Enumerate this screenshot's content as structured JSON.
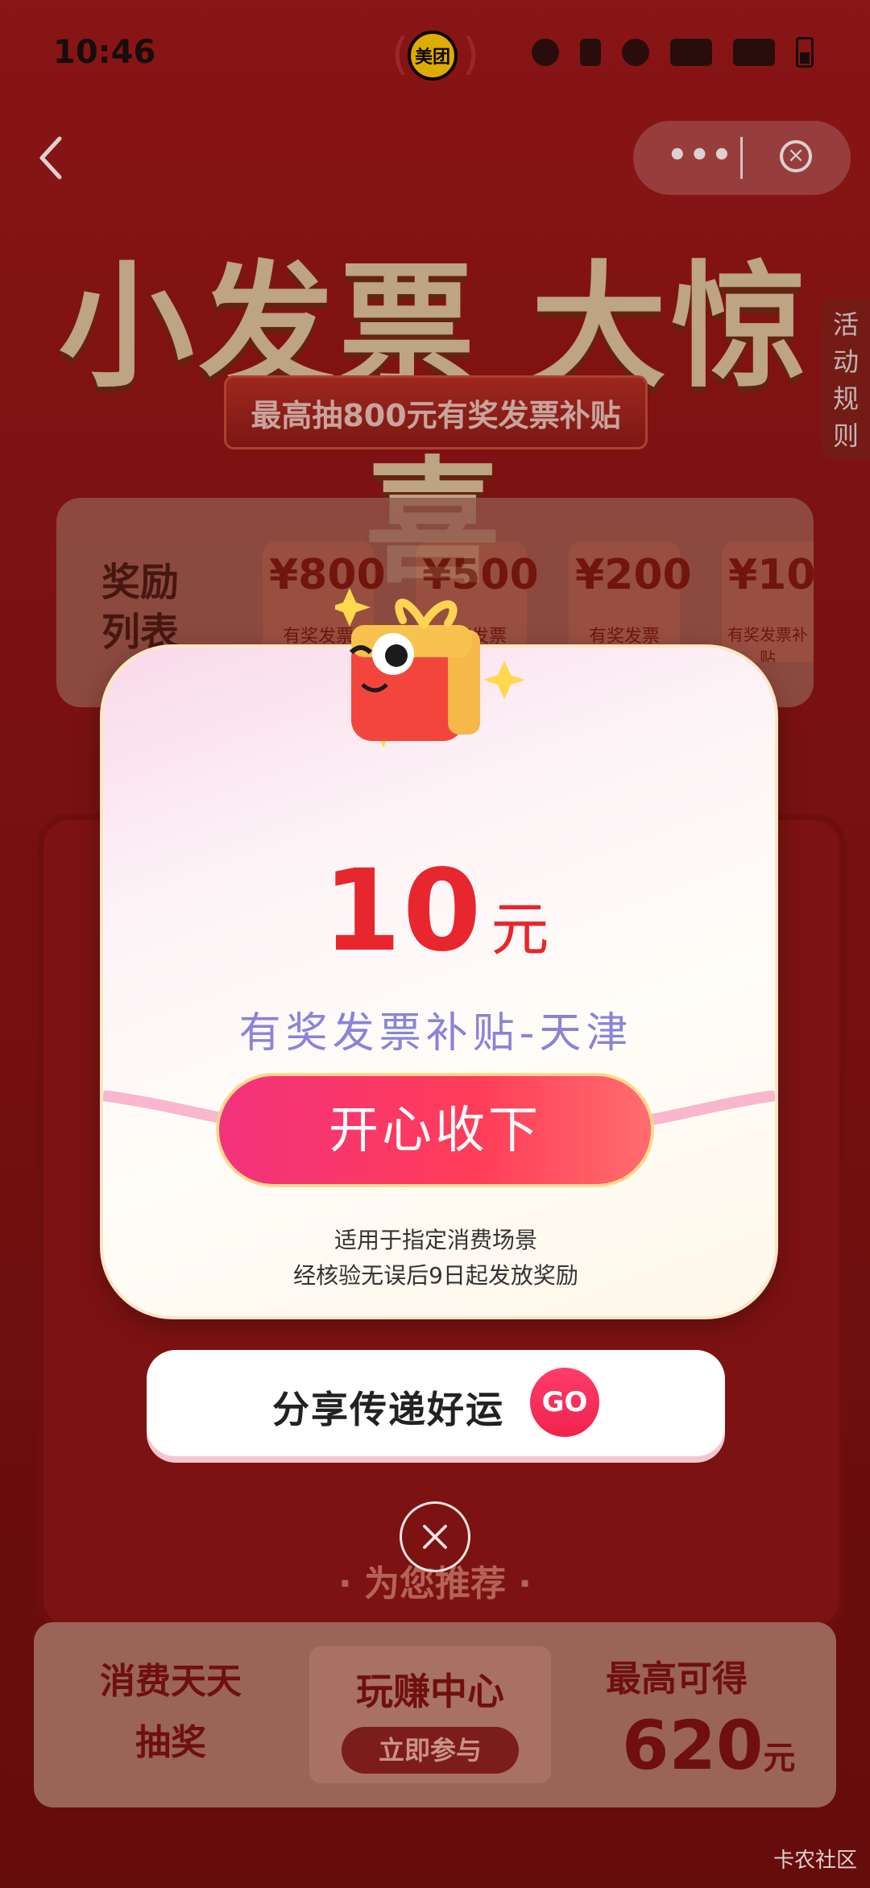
{
  "status_bar": {
    "time": "10:46",
    "app_logo": "美团"
  },
  "nav": {
    "more_label": "•••"
  },
  "hero": {
    "title": "小发票 大惊喜",
    "subtitle": "最高抽800元有奖发票补贴",
    "rules_tab": "活动规则"
  },
  "rewards": {
    "label": "奖励列表",
    "items": [
      {
        "amount": "¥800",
        "tag": "有奖发票"
      },
      {
        "amount": "¥500",
        "tag": "有奖发票"
      },
      {
        "amount": "¥200",
        "tag": "有奖发票"
      },
      {
        "amount": "¥10",
        "tag": "有奖发票补贴"
      }
    ]
  },
  "background": {
    "recommend_label": "· 为您推荐 ·",
    "banner_left": "消费天天抽奖",
    "banner_mid_title": "玩赚中心",
    "banner_mid_button": "立即参与",
    "banner_right_title": "最高可得",
    "banner_right_value": "620",
    "banner_right_unit": "元"
  },
  "modal": {
    "amount": "10",
    "unit": "元",
    "subsidy": "有奖发票补贴-天津",
    "accept_button": "开心收下",
    "note_line1": "适用于指定消费场景",
    "note_line2": "经核验无误后9日起发放奖励"
  },
  "share": {
    "label": "分享传递好运",
    "go": "GO"
  },
  "watermark": "卡农社区",
  "colors": {
    "accent_red": "#e8262d",
    "subsidy_purple": "#8a83d8",
    "button_pink": "#f2327c"
  }
}
